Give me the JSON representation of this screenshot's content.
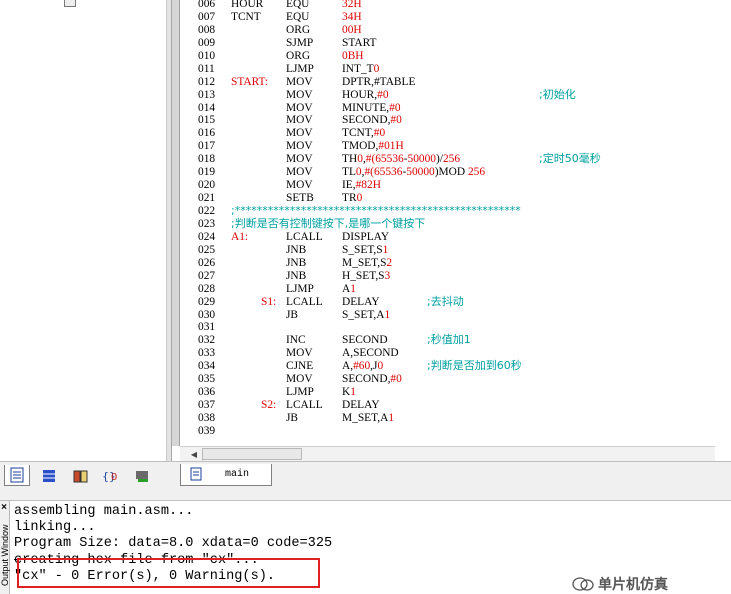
{
  "editor": {
    "lines": [
      {
        "n": "006",
        "label": "HOUR",
        "op": "EQU",
        "arg": "32H",
        "comment": "",
        "arg_red": true
      },
      {
        "n": "007",
        "label": "TCNT",
        "op": "EQU",
        "arg": "34H",
        "comment": "",
        "arg_red": true
      },
      {
        "n": "008",
        "label": "",
        "op": "ORG",
        "arg": "00H",
        "comment": "",
        "arg_red": true
      },
      {
        "n": "009",
        "label": "",
        "op": "SJMP",
        "arg": "START",
        "comment": ""
      },
      {
        "n": "010",
        "label": "",
        "op": "ORG",
        "arg": "0BH",
        "comment": "",
        "arg_red": true
      },
      {
        "n": "011",
        "label": "",
        "op": "LJMP",
        "arg": "INT_T0",
        "comment": ""
      },
      {
        "n": "012",
        "label": "START:",
        "op": "MOV",
        "arg": "DPTR,#TABLE",
        "comment": "",
        "label_red": true
      },
      {
        "n": "013",
        "label": "",
        "op": "MOV",
        "arg": "HOUR,#0",
        "comment": ";初始化"
      },
      {
        "n": "014",
        "label": "",
        "op": "MOV",
        "arg": "MINUTE,#0",
        "comment": ""
      },
      {
        "n": "015",
        "label": "",
        "op": "MOV",
        "arg": "SECOND,#0",
        "comment": ""
      },
      {
        "n": "016",
        "label": "",
        "op": "MOV",
        "arg": "TCNT,#0",
        "comment": ""
      },
      {
        "n": "017",
        "label": "",
        "op": "MOV",
        "arg": "TMOD,#01H",
        "comment": ""
      },
      {
        "n": "018",
        "label": "",
        "op": "MOV",
        "arg": "TH0,#(65536-50000)/256",
        "comment": ";定时50毫秒"
      },
      {
        "n": "019",
        "label": "",
        "op": "MOV",
        "arg": "TL0,#(65536-50000)MOD 256",
        "comment": ""
      },
      {
        "n": "020",
        "label": "",
        "op": "MOV",
        "arg": "IE,#82H",
        "comment": ""
      },
      {
        "n": "021",
        "label": "",
        "op": "SETB",
        "arg": "TR0",
        "comment": ""
      },
      {
        "n": "022",
        "full": ";****************************************************"
      },
      {
        "n": "023",
        "full": ";判断是否有控制键按下,是哪一个键按下"
      },
      {
        "n": "024",
        "label": "A1:",
        "op": "LCALL",
        "arg": "DISPLAY",
        "comment": "",
        "label_red": true
      },
      {
        "n": "025",
        "label": "",
        "op": "JNB",
        "arg": "S_SET,S1",
        "comment": ""
      },
      {
        "n": "026",
        "label": "",
        "op": "JNB",
        "arg": "M_SET,S2",
        "comment": ""
      },
      {
        "n": "027",
        "label": "",
        "op": "JNB",
        "arg": "H_SET,S3",
        "comment": ""
      },
      {
        "n": "028",
        "label": "",
        "op": "LJMP",
        "arg": "A1",
        "comment": ""
      },
      {
        "n": "029",
        "label": "S1:",
        "op": "LCALL",
        "arg": "DELAY",
        "comment2": ";去抖动",
        "label_red": true,
        "indent": true
      },
      {
        "n": "030",
        "label": "",
        "op": "JB",
        "arg": "S_SET,A1",
        "comment": ""
      },
      {
        "n": "031",
        "label": "",
        "op": "",
        "arg": "",
        "comment": ""
      },
      {
        "n": "032",
        "label": "",
        "op": "INC",
        "arg": "SECOND",
        "comment2": ";秒值加1"
      },
      {
        "n": "033",
        "label": "",
        "op": "MOV",
        "arg": "A,SECOND",
        "comment": ""
      },
      {
        "n": "034",
        "label": "",
        "op": "CJNE",
        "arg": "A,#60,J0",
        "comment2": ";判断是否加到60秒"
      },
      {
        "n": "035",
        "label": "",
        "op": "MOV",
        "arg": "SECOND,#0",
        "comment": ""
      },
      {
        "n": "036",
        "label": "",
        "op": "LJMP",
        "arg": "K1",
        "comment": ""
      },
      {
        "n": "037",
        "label": "S2:",
        "op": "LCALL",
        "arg": "DELAY",
        "comment": "",
        "label_red": true,
        "indent": true
      },
      {
        "n": "038",
        "label": "",
        "op": "JB",
        "arg": "M_SET,A1",
        "comment": ""
      },
      {
        "n": "039",
        "label": "",
        "op": "",
        "arg": "",
        "comment": ""
      }
    ],
    "tab_label": "main"
  },
  "output": {
    "title": "Output Window",
    "close": "×",
    "lines": [
      "assembling main.asm...",
      "linking...",
      "Program Size: data=8.0 xdata=0 code=325",
      "creating hex file from \"cx\"...",
      "\"cx\" - 0 Error(s), 0 Warning(s)."
    ]
  },
  "watermark": "单片机仿真",
  "colors": {
    "red": "#e00000",
    "teal": "#00a0a0",
    "highlight": "#e02020"
  }
}
